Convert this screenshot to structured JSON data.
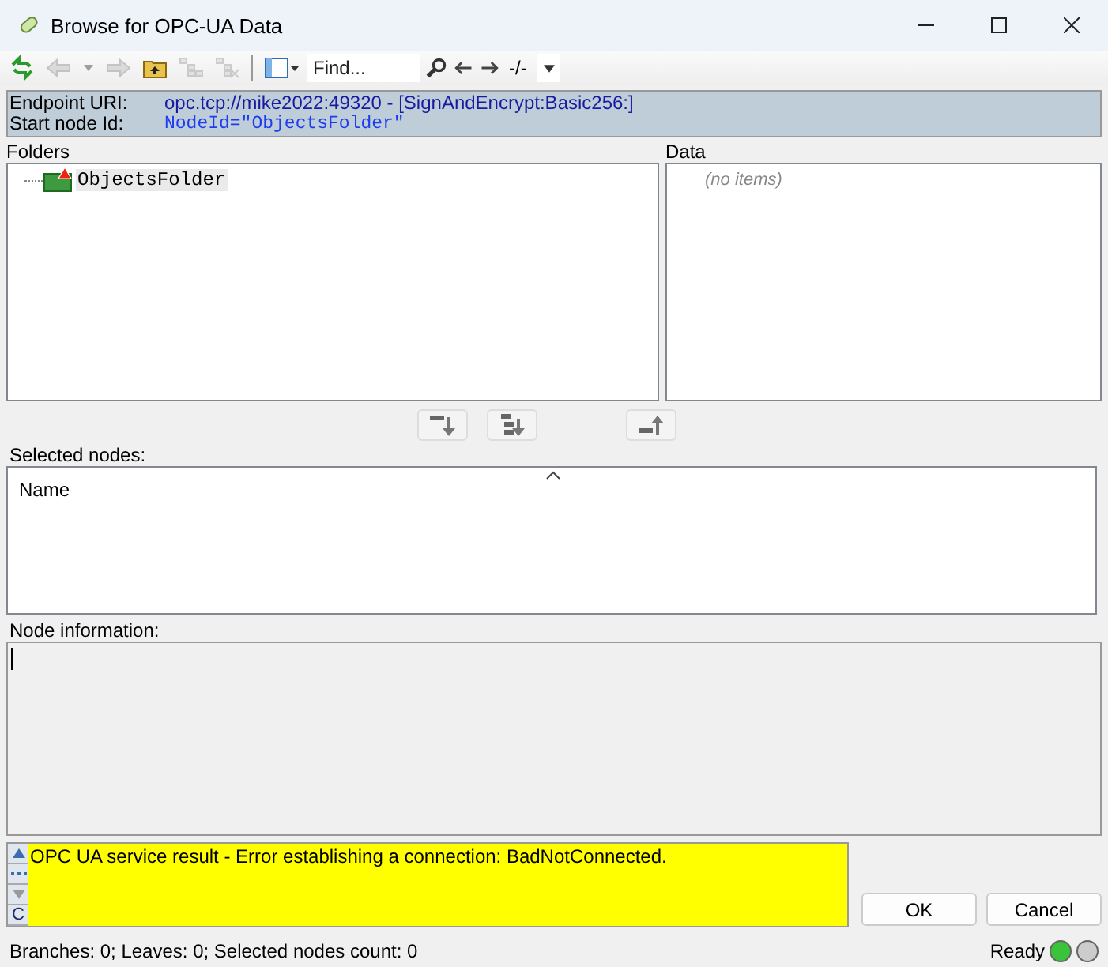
{
  "window": {
    "title": "Browse for OPC-UA Data"
  },
  "toolbar": {
    "items": [
      {
        "kind": "refresh",
        "disabled": false
      },
      {
        "kind": "back",
        "disabled": true
      },
      {
        "kind": "caret",
        "disabled": true
      },
      {
        "kind": "forward",
        "disabled": true
      },
      {
        "kind": "folder-up",
        "disabled": false
      },
      {
        "kind": "tree",
        "disabled": true
      },
      {
        "kind": "tree-remove",
        "disabled": true
      },
      {
        "kind": "separator"
      },
      {
        "kind": "view",
        "disabled": false
      }
    ],
    "find": {
      "placeholder": "Find..."
    },
    "find_counter": "-/-"
  },
  "info": [
    {
      "label": "Endpoint URI:",
      "value": "opc.tcp://mike2022:49320 - [SignAndEncrypt:Basic256:]",
      "kind": "plain"
    },
    {
      "label": "Start node Id:",
      "value": "NodeId=\"ObjectsFolder\"",
      "kind": "mono"
    }
  ],
  "folders": {
    "label": "Folders",
    "items": [
      {
        "name": "ObjectsFolder",
        "selected": true,
        "warning": true
      }
    ]
  },
  "data": {
    "label": "Data",
    "empty_text": "(no items)"
  },
  "move_buttons": [
    {
      "kind": "add",
      "disabled": false
    },
    {
      "kind": "add-all",
      "disabled": false
    },
    {
      "kind": "remove",
      "disabled": false
    }
  ],
  "selected_nodes": {
    "label": "Selected nodes:",
    "columns": [
      "Name"
    ]
  },
  "node_information": {
    "label": "Node information:"
  },
  "message": {
    "text": "OPC UA service result - Error establishing a connection: BadNotConnected.",
    "clear_label": "C"
  },
  "buttons": [
    "OK",
    "Cancel"
  ],
  "status_bar": {
    "text": "Branches: 0; Leaves: 0; Selected nodes count: 0",
    "state": "Ready",
    "lights": [
      {
        "on": true
      },
      {
        "on": false
      }
    ]
  }
}
